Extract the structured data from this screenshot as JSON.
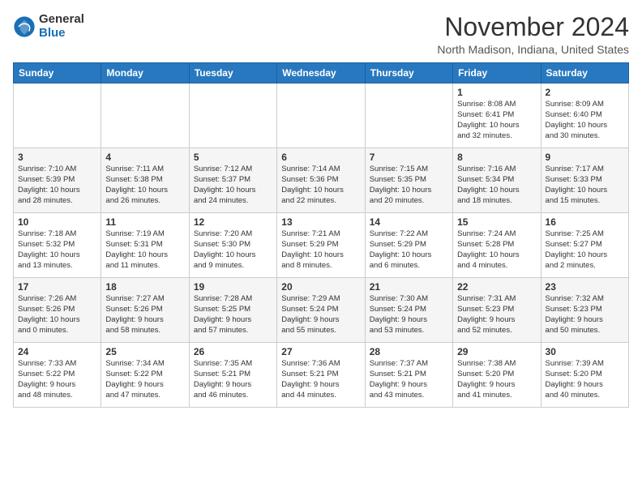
{
  "header": {
    "logo_general": "General",
    "logo_blue": "Blue",
    "month_year": "November 2024",
    "location": "North Madison, Indiana, United States"
  },
  "weekdays": [
    "Sunday",
    "Monday",
    "Tuesday",
    "Wednesday",
    "Thursday",
    "Friday",
    "Saturday"
  ],
  "weeks": [
    [
      {
        "day": "",
        "info": ""
      },
      {
        "day": "",
        "info": ""
      },
      {
        "day": "",
        "info": ""
      },
      {
        "day": "",
        "info": ""
      },
      {
        "day": "",
        "info": ""
      },
      {
        "day": "1",
        "info": "Sunrise: 8:08 AM\nSunset: 6:41 PM\nDaylight: 10 hours\nand 32 minutes."
      },
      {
        "day": "2",
        "info": "Sunrise: 8:09 AM\nSunset: 6:40 PM\nDaylight: 10 hours\nand 30 minutes."
      }
    ],
    [
      {
        "day": "3",
        "info": "Sunrise: 7:10 AM\nSunset: 5:39 PM\nDaylight: 10 hours\nand 28 minutes."
      },
      {
        "day": "4",
        "info": "Sunrise: 7:11 AM\nSunset: 5:38 PM\nDaylight: 10 hours\nand 26 minutes."
      },
      {
        "day": "5",
        "info": "Sunrise: 7:12 AM\nSunset: 5:37 PM\nDaylight: 10 hours\nand 24 minutes."
      },
      {
        "day": "6",
        "info": "Sunrise: 7:14 AM\nSunset: 5:36 PM\nDaylight: 10 hours\nand 22 minutes."
      },
      {
        "day": "7",
        "info": "Sunrise: 7:15 AM\nSunset: 5:35 PM\nDaylight: 10 hours\nand 20 minutes."
      },
      {
        "day": "8",
        "info": "Sunrise: 7:16 AM\nSunset: 5:34 PM\nDaylight: 10 hours\nand 18 minutes."
      },
      {
        "day": "9",
        "info": "Sunrise: 7:17 AM\nSunset: 5:33 PM\nDaylight: 10 hours\nand 15 minutes."
      }
    ],
    [
      {
        "day": "10",
        "info": "Sunrise: 7:18 AM\nSunset: 5:32 PM\nDaylight: 10 hours\nand 13 minutes."
      },
      {
        "day": "11",
        "info": "Sunrise: 7:19 AM\nSunset: 5:31 PM\nDaylight: 10 hours\nand 11 minutes."
      },
      {
        "day": "12",
        "info": "Sunrise: 7:20 AM\nSunset: 5:30 PM\nDaylight: 10 hours\nand 9 minutes."
      },
      {
        "day": "13",
        "info": "Sunrise: 7:21 AM\nSunset: 5:29 PM\nDaylight: 10 hours\nand 8 minutes."
      },
      {
        "day": "14",
        "info": "Sunrise: 7:22 AM\nSunset: 5:29 PM\nDaylight: 10 hours\nand 6 minutes."
      },
      {
        "day": "15",
        "info": "Sunrise: 7:24 AM\nSunset: 5:28 PM\nDaylight: 10 hours\nand 4 minutes."
      },
      {
        "day": "16",
        "info": "Sunrise: 7:25 AM\nSunset: 5:27 PM\nDaylight: 10 hours\nand 2 minutes."
      }
    ],
    [
      {
        "day": "17",
        "info": "Sunrise: 7:26 AM\nSunset: 5:26 PM\nDaylight: 10 hours\nand 0 minutes."
      },
      {
        "day": "18",
        "info": "Sunrise: 7:27 AM\nSunset: 5:26 PM\nDaylight: 9 hours\nand 58 minutes."
      },
      {
        "day": "19",
        "info": "Sunrise: 7:28 AM\nSunset: 5:25 PM\nDaylight: 9 hours\nand 57 minutes."
      },
      {
        "day": "20",
        "info": "Sunrise: 7:29 AM\nSunset: 5:24 PM\nDaylight: 9 hours\nand 55 minutes."
      },
      {
        "day": "21",
        "info": "Sunrise: 7:30 AM\nSunset: 5:24 PM\nDaylight: 9 hours\nand 53 minutes."
      },
      {
        "day": "22",
        "info": "Sunrise: 7:31 AM\nSunset: 5:23 PM\nDaylight: 9 hours\nand 52 minutes."
      },
      {
        "day": "23",
        "info": "Sunrise: 7:32 AM\nSunset: 5:23 PM\nDaylight: 9 hours\nand 50 minutes."
      }
    ],
    [
      {
        "day": "24",
        "info": "Sunrise: 7:33 AM\nSunset: 5:22 PM\nDaylight: 9 hours\nand 48 minutes."
      },
      {
        "day": "25",
        "info": "Sunrise: 7:34 AM\nSunset: 5:22 PM\nDaylight: 9 hours\nand 47 minutes."
      },
      {
        "day": "26",
        "info": "Sunrise: 7:35 AM\nSunset: 5:21 PM\nDaylight: 9 hours\nand 46 minutes."
      },
      {
        "day": "27",
        "info": "Sunrise: 7:36 AM\nSunset: 5:21 PM\nDaylight: 9 hours\nand 44 minutes."
      },
      {
        "day": "28",
        "info": "Sunrise: 7:37 AM\nSunset: 5:21 PM\nDaylight: 9 hours\nand 43 minutes."
      },
      {
        "day": "29",
        "info": "Sunrise: 7:38 AM\nSunset: 5:20 PM\nDaylight: 9 hours\nand 41 minutes."
      },
      {
        "day": "30",
        "info": "Sunrise: 7:39 AM\nSunset: 5:20 PM\nDaylight: 9 hours\nand 40 minutes."
      }
    ]
  ]
}
